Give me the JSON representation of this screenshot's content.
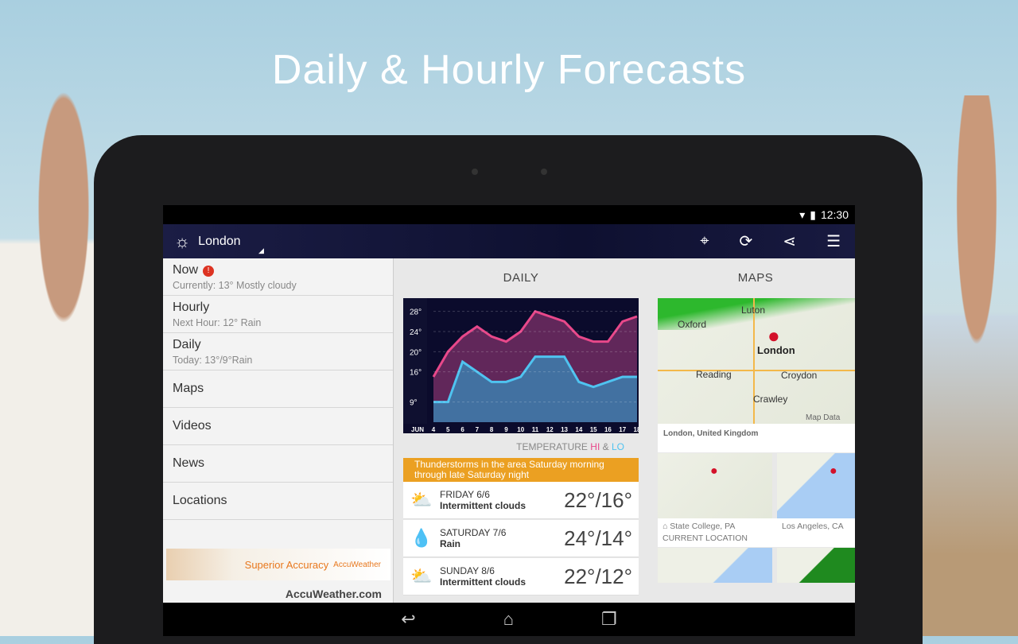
{
  "headline": "Daily & Hourly Forecasts",
  "status": {
    "time": "12:30"
  },
  "appbar": {
    "location": "London",
    "icons": [
      "crosshair-icon",
      "refresh-icon",
      "share-icon",
      "settings-sliders-icon"
    ]
  },
  "sidebar": {
    "items": [
      {
        "title": "Now",
        "sub": "Currently: 13° Mostly cloudy",
        "alert": "!"
      },
      {
        "title": "Hourly",
        "sub": "Next Hour: 12° Rain"
      },
      {
        "title": "Daily",
        "sub": "Today: 13°/9°Rain"
      },
      {
        "title": "Maps"
      },
      {
        "title": "Videos"
      },
      {
        "title": "News"
      },
      {
        "title": "Locations"
      }
    ],
    "ad": {
      "text": "Superior Accuracy",
      "brand": "AccuWeather"
    },
    "logo": "AccuWeather.com"
  },
  "daily": {
    "header": "DAILY",
    "legend": {
      "prefix": "TEMPERATURE",
      "hi": "HI",
      "amp": "&",
      "lo": "LO"
    },
    "alert": "Thunderstorms in the area Saturday morning through late Saturday night",
    "days": [
      {
        "name": "FRIDAY 6/6",
        "cond": "Intermittent clouds",
        "temp": "22°/16°",
        "icon": "partly-cloudy-icon"
      },
      {
        "name": "SATURDAY 7/6",
        "cond": "Rain",
        "temp": "24°/14°",
        "icon": "rain-icon"
      },
      {
        "name": "SUNDAY 8/6",
        "cond": "Intermittent clouds",
        "temp": "22°/12°",
        "icon": "partly-cloudy-icon"
      }
    ]
  },
  "maps": {
    "header": "MAPS",
    "main": {
      "caption": "London, United Kingdom",
      "labels": [
        "Luton",
        "Oxford",
        "London",
        "Reading",
        "Croydon",
        "Crawley",
        "Map Data"
      ]
    },
    "cards": [
      {
        "caption": "State College, PA",
        "sub": "CURRENT LOCATION"
      },
      {
        "caption": "Los Angeles, CA"
      }
    ]
  },
  "chart_data": {
    "type": "area",
    "month_label": "JUN",
    "categories": [
      "4",
      "5",
      "6",
      "7",
      "8",
      "9",
      "10",
      "11",
      "12",
      "13",
      "14",
      "15",
      "16",
      "17",
      "18"
    ],
    "y_ticks": [
      "28°",
      "24°",
      "20°",
      "16°",
      "9°"
    ],
    "series": [
      {
        "name": "HI",
        "color": "#e8488a",
        "values": [
          15,
          20,
          23,
          25,
          23,
          22,
          24,
          28,
          27,
          26,
          23,
          22,
          22,
          26,
          27
        ]
      },
      {
        "name": "LO",
        "color": "#4fc3f0",
        "values": [
          10,
          10,
          18,
          16,
          14,
          14,
          15,
          19,
          19,
          19,
          14,
          13,
          14,
          15,
          15
        ]
      }
    ],
    "ylim": [
      6,
      30
    ]
  },
  "colors": {
    "accent": "#eba022",
    "hi": "#e8488a",
    "lo": "#4fc3f0"
  }
}
